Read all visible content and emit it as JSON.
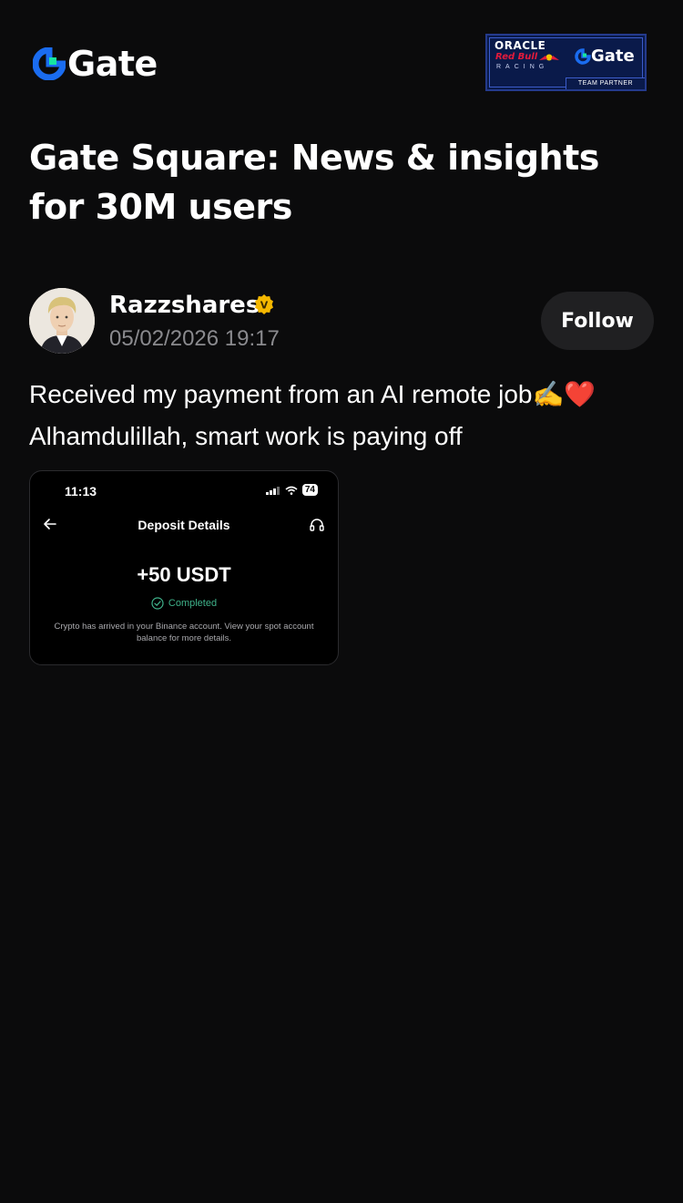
{
  "header": {
    "logo_text": "Gate",
    "partner_badge": {
      "oracle": "ORACLE",
      "redbull": "Red Bull",
      "racing": "RACING",
      "gate": "Gate",
      "team_partner": "TEAM PARTNER"
    }
  },
  "page": {
    "title": "Gate Square: News & insights for 30M users"
  },
  "post": {
    "author": "Razzshares",
    "verified_badge": "V",
    "timestamp": "05/02/2026 19:17",
    "follow_label": "Follow",
    "body_line1": "Received my payment from an AI remote job✍️❤️",
    "body_line2": "Alhamdulillah, smart work is paying off",
    "attachment": {
      "status_time": "11:13",
      "battery": "74",
      "title": "Deposit Details",
      "amount": "+50 USDT",
      "status": "Completed",
      "note": "Crypto has arrived in your Binance account. View your spot account balance for more details."
    }
  },
  "colors": {
    "background": "#0b0b0c",
    "brand_blue": "#1a6cf0",
    "brand_green": "#17e5a1",
    "verified_gold": "#f5b800",
    "follow_bg": "#202022",
    "muted_text": "#8a8a8e",
    "success_green": "#3fb28a"
  },
  "icons": {
    "logo": "gate-logo-icon",
    "verified": "verified-badge-icon",
    "back": "back-arrow-icon",
    "support": "headset-icon",
    "check": "check-circle-icon"
  }
}
